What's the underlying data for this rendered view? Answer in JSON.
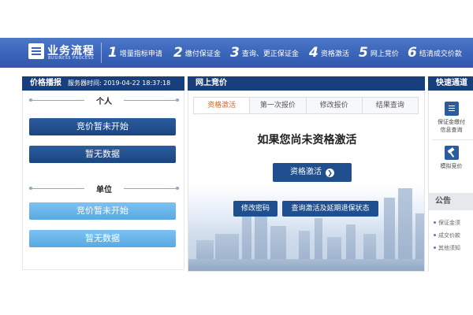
{
  "header": {
    "logo_title": "业务流程",
    "logo_subtitle": "BUSINESS PROCESS",
    "steps": [
      {
        "num": "1",
        "label": "增量指标申请"
      },
      {
        "num": "2",
        "label": "缴付保证金"
      },
      {
        "num": "3",
        "label": "查询、更正保证金"
      },
      {
        "num": "4",
        "label": "资格激活"
      },
      {
        "num": "5",
        "label": "网上竞价"
      },
      {
        "num": "6",
        "label": "结清成交价款"
      }
    ]
  },
  "price_panel": {
    "title": "价格播报",
    "server_time": "服务器时间: 2019-04-22 18:37:18",
    "personal": {
      "title": "个人",
      "status_button": "竞价暂未开始",
      "data_button": "暂无数据"
    },
    "company": {
      "title": "单位",
      "status_button": "竞价暂未开始",
      "data_button": "暂无数据"
    }
  },
  "bidding_panel": {
    "title": "网上竞价",
    "tabs": [
      "资格激活",
      "第一次报价",
      "修改报价",
      "结果查询"
    ],
    "active_tab": 0,
    "headline": "如果您尚未资格激活",
    "activate_button": "资格激活",
    "change_password_button": "修改密码",
    "query_button": "查询激活及延期退保状态"
  },
  "quick_panel": {
    "title": "快速通道",
    "items": [
      {
        "icon": "document-icon",
        "label_line1": "保证金缴付",
        "label_line2": "信息查询"
      },
      {
        "icon": "hammer-icon",
        "label_line1": "模拟竞价",
        "label_line2": ""
      }
    ],
    "notice_title": "公告",
    "notices": [
      "保证金须",
      "成交价款",
      "其他须知"
    ]
  }
}
